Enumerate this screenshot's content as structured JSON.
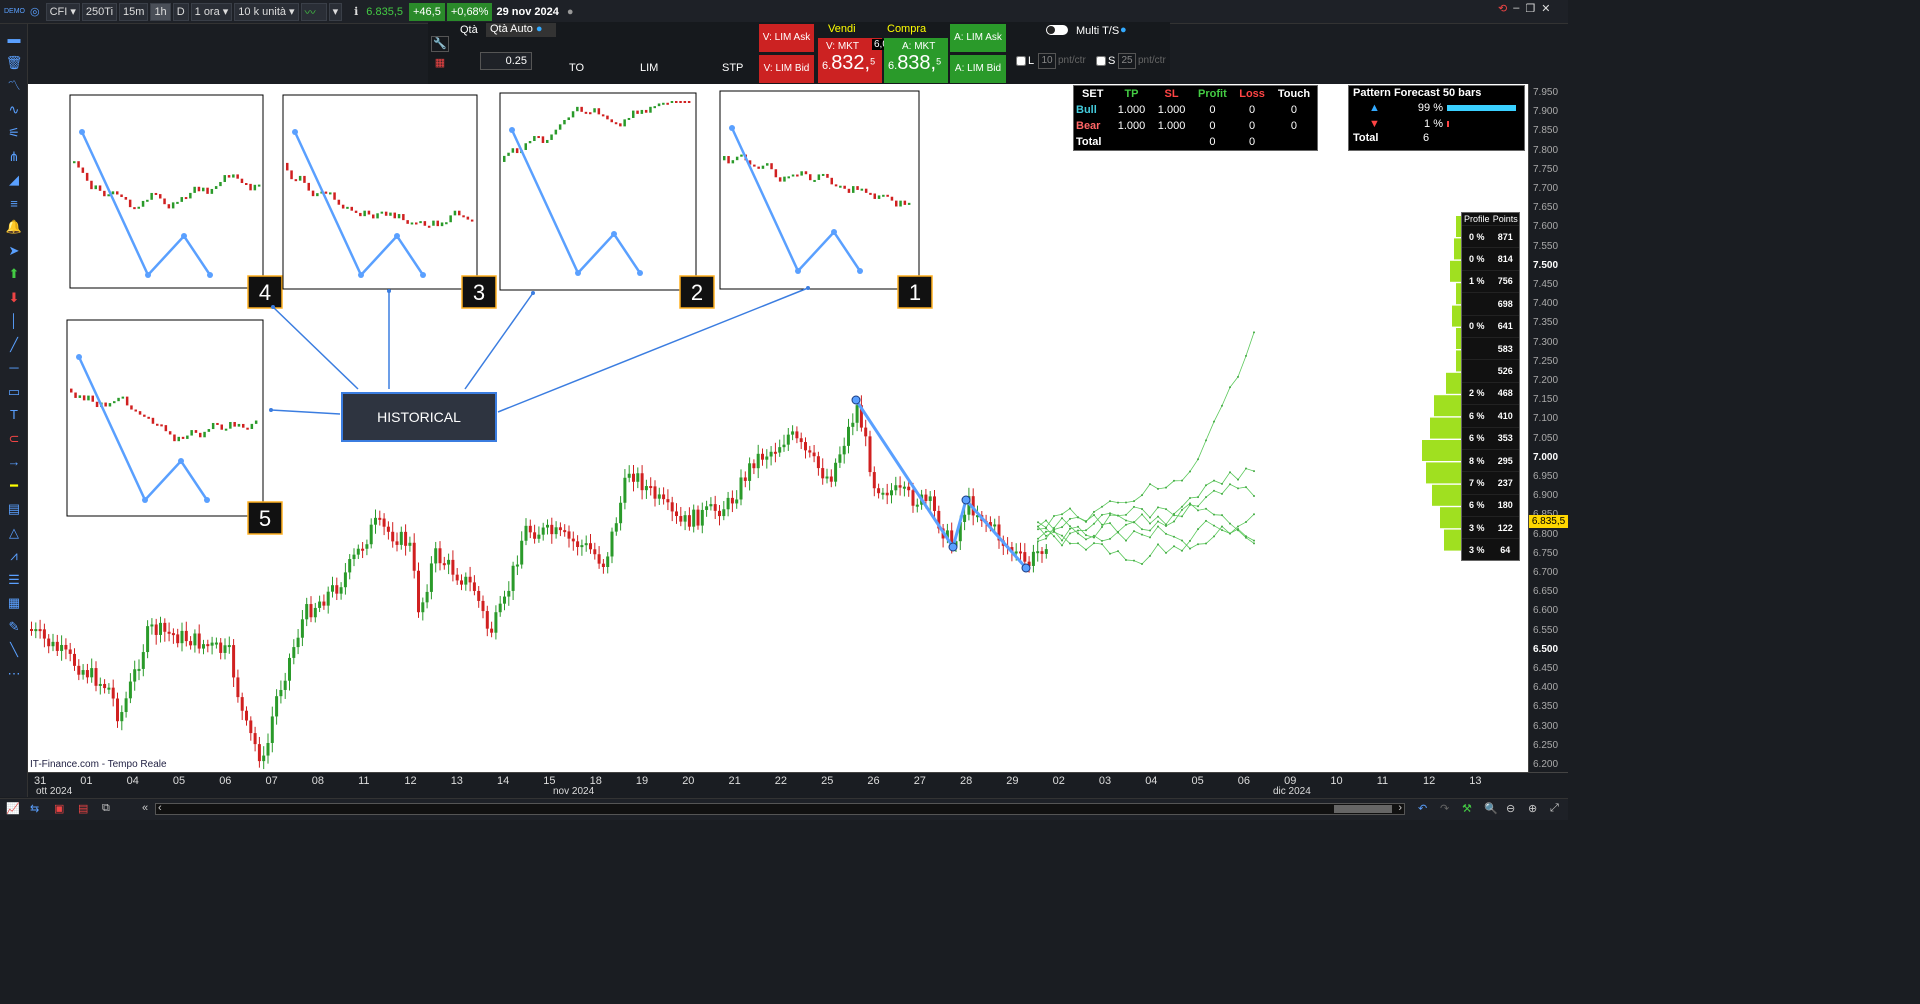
{
  "toolbar": {
    "demo": "DEMO",
    "symbol": "CFI",
    "tick": "250Ti",
    "tf1": "15m",
    "tf2": "1h",
    "tf3": "D",
    "period": "1 ora",
    "units": "10 k unità",
    "price": "6.835,5",
    "change": "+46,5",
    "pct": "+0,68%",
    "date": "29 nov 2024"
  },
  "trade": {
    "qta_label": "Qtà",
    "qta_auto": "Qtà Auto",
    "qta_value": "0.25",
    "to": "TO",
    "lim": "LIM",
    "stp": "STP",
    "v_lim_ask": "V: LIM Ask",
    "v_lim_bid": "V: LIM Bid",
    "vendi": "Vendi",
    "compra": "Compra",
    "v_mkt": "V: MKT",
    "a_mkt": "A: MKT",
    "spread": "6,0",
    "sell_int": "6.",
    "sell_big": "832,",
    "sell_sup": "5",
    "buy_int": "6.",
    "buy_big": "838,",
    "buy_sup": "5",
    "a_lim_ask": "A: LIM Ask",
    "a_lim_bid": "A: LIM Bid",
    "multi": "Multi T/S",
    "l": "L",
    "l_val": "10",
    "s": "S",
    "s_val": "25",
    "unit": "pnt/ctr"
  },
  "set_table": {
    "headers": [
      "SET",
      "TP",
      "SL",
      "Profit",
      "Loss",
      "Touch"
    ],
    "rows": [
      [
        "Bull",
        "1.000",
        "1.000",
        "0",
        "0",
        "0"
      ],
      [
        "Bear",
        "1.000",
        "1.000",
        "0",
        "0",
        "0"
      ],
      [
        "Total",
        "",
        "",
        "0",
        "0",
        ""
      ]
    ]
  },
  "forecast": {
    "title": "Pattern Forecast 50  bars",
    "up": "99 %",
    "down": "1 %",
    "total_label": "Total",
    "total": "6",
    "up_frac": 0.99,
    "down_frac": 0.01
  },
  "profile": {
    "headers": [
      "Profile",
      "Points"
    ],
    "rows": [
      [
        "0 %",
        "871"
      ],
      [
        "0 %",
        "814"
      ],
      [
        "1 %",
        "756"
      ],
      [
        "",
        "698"
      ],
      [
        "0 %",
        "641"
      ],
      [
        "",
        "583"
      ],
      [
        "",
        "526"
      ],
      [
        "2 %",
        "468"
      ],
      [
        "6 %",
        "410"
      ],
      [
        "6 %",
        "353"
      ],
      [
        "8 %",
        "295"
      ],
      [
        "7 %",
        "237"
      ],
      [
        "6 %",
        "180"
      ],
      [
        "3 %",
        "122"
      ],
      [
        "3 %",
        "64"
      ]
    ]
  },
  "price_axis": [
    "7.950",
    "7.900",
    "7.850",
    "7.800",
    "7.750",
    "7.700",
    "7.650",
    "7.600",
    "7.550",
    "7.500",
    "7.450",
    "7.400",
    "7.350",
    "7.300",
    "7.250",
    "7.200",
    "7.150",
    "7.100",
    "7.050",
    "7.000",
    "6.950",
    "6.900",
    "6.850",
    "6.800",
    "6.750",
    "6.700",
    "6.650",
    "6.600",
    "6.550",
    "6.500",
    "6.450",
    "6.400",
    "6.350",
    "6.300",
    "6.250",
    "6.200"
  ],
  "current_price": "6.835,5",
  "time_axis": [
    "31",
    "01",
    "04",
    "05",
    "06",
    "07",
    "08",
    "11",
    "12",
    "13",
    "14",
    "15",
    "18",
    "19",
    "20",
    "21",
    "22",
    "25",
    "26",
    "27",
    "28",
    "29",
    "02",
    "03",
    "04",
    "05",
    "06",
    "09",
    "10",
    "11",
    "12",
    "13"
  ],
  "month_labels": [
    "ott 2024",
    "nov 2024",
    "dic 2024"
  ],
  "historical_label": "HISTORICAL",
  "thumb_numbers": [
    "4",
    "3",
    "2",
    "1",
    "5"
  ],
  "source": "IT-Finance.com - Tempo Reale"
}
